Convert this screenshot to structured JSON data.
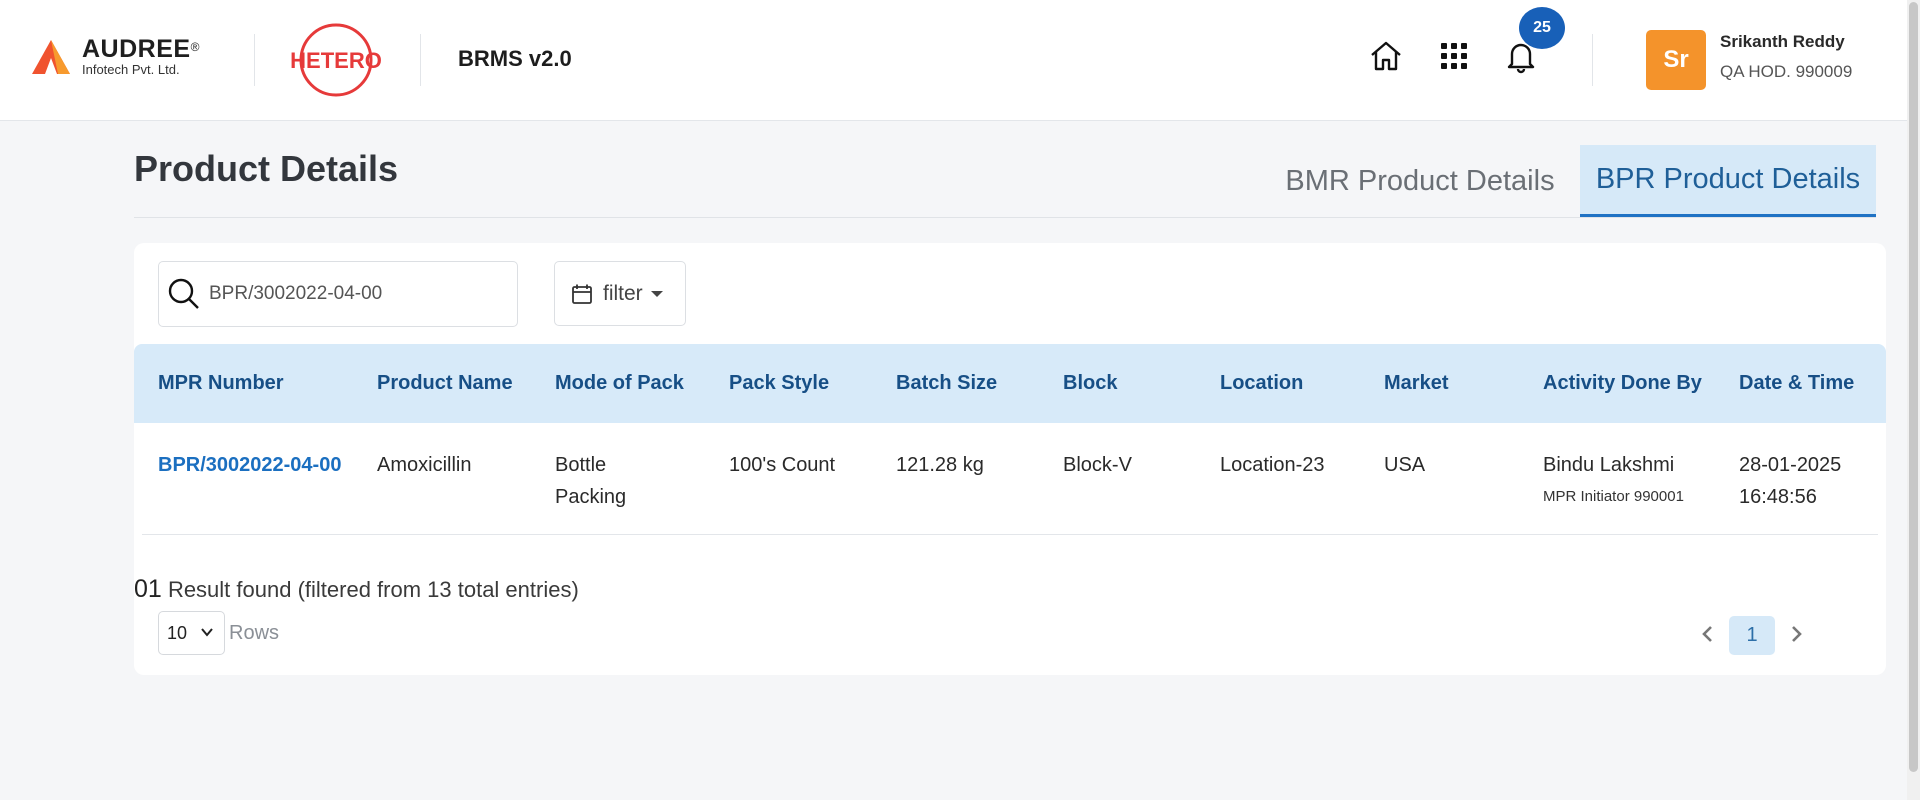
{
  "header": {
    "audree_logo": {
      "name": "AUDREE",
      "reg": "®",
      "subtitle": "Infotech Pvt. Ltd."
    },
    "hetero_logo": {
      "text": "HETERO",
      "color": "#e63a3a"
    },
    "app_name": "BRMS v2.0",
    "icons": [
      "home-icon",
      "apps-grid-icon",
      "bell-icon"
    ],
    "notification_count": "25",
    "user": {
      "initials": "Sr",
      "name": "Srikanth Reddy",
      "role": "QA HOD. 990009"
    }
  },
  "page": {
    "title": "Product Details",
    "tabs": [
      {
        "label": "BMR Product Details",
        "active": false
      },
      {
        "label": "BPR Product Details",
        "active": true
      }
    ]
  },
  "toolbar": {
    "search_value": "BPR/3002022-04-00",
    "filter_label": "filter"
  },
  "table": {
    "columns": [
      "MPR Number",
      "Product Name",
      "Mode of Pack",
      "Pack Style",
      "Batch Size",
      "Block",
      "Location",
      "Market",
      "Activity Done By",
      "Date & Time"
    ],
    "rows": [
      {
        "mpr_number": "BPR/3002022-04-00",
        "product_name": "Amoxicillin",
        "mode_of_pack_1": "Bottle",
        "mode_of_pack_2": "Packing",
        "pack_style": "100's Count",
        "batch_size": "121.28 kg",
        "block": "Block-V",
        "location": "Location-23",
        "market": "USA",
        "activity_by": "Bindu Lakshmi",
        "activity_role": "MPR Initiator 990001",
        "date": "28-01-2025",
        "time": "16:48:56"
      }
    ]
  },
  "footer": {
    "result_count": "01",
    "result_text": "Result found (filtered from 13 total entries)",
    "rows_value": "10",
    "rows_label": "Rows",
    "current_page": "1"
  },
  "colors": {
    "accent": "#1f72c4",
    "header_row_bg": "#d7eaf9",
    "avatar_bg": "#f4932b",
    "badge_bg": "#1860b8"
  }
}
